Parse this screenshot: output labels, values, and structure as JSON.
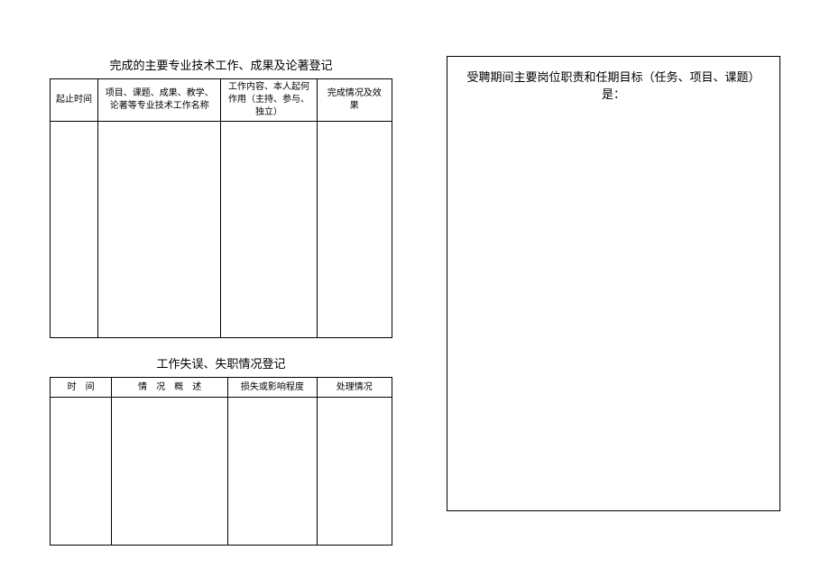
{
  "left": {
    "section1_title": "完成的主要专业技术工作、成果及论著登记",
    "tbl1_headers": {
      "c1": "起止时间",
      "c2": "项目、课题、成果、教学、论著等专业技术工作名称",
      "c3": "工作内容、本人起何作用（主持、参与、独立）",
      "c4": "完成情况及效　果"
    },
    "section2_title": "工作失误、失职情况登记",
    "tbl2_headers": {
      "c1": "时　间",
      "c2": "情　况　概　述",
      "c3": "损失或影响程度",
      "c4": "处理情况"
    }
  },
  "right": {
    "box_title": "受聘期间主要岗位职责和任期目标（任务、项目、课题）是："
  }
}
